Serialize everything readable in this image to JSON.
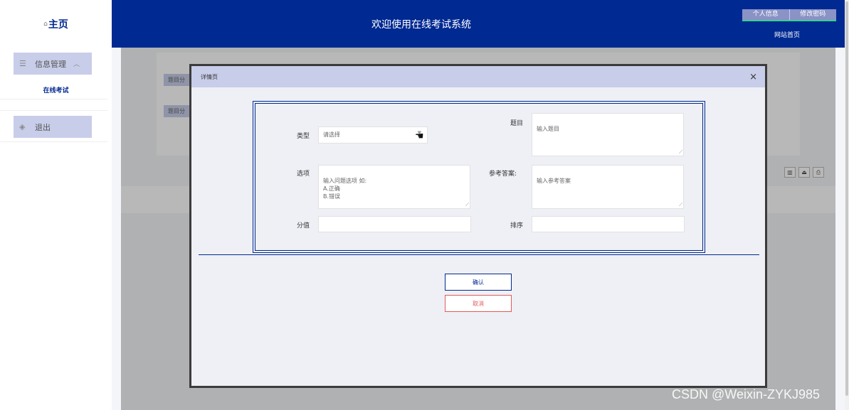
{
  "app": {
    "home_glyph": "⌂",
    "logo_label": "主页",
    "header_title": "欢迎使用在线考试系统"
  },
  "header": {
    "personal_info": "个人信息",
    "change_password": "修改密码",
    "site_home": "网站首页"
  },
  "sidebar": {
    "groups": [
      {
        "label": "信息管理",
        "icon": "list-icon",
        "expanded": true,
        "items": [
          {
            "label": "在线考试"
          }
        ]
      },
      {
        "label": "退出",
        "icon": "layers-icon"
      }
    ]
  },
  "background": {
    "btn1": "题目分",
    "btn2": "题目分"
  },
  "dialog": {
    "title": "详情页",
    "fields": {
      "type": {
        "label": "类型",
        "placeholder": "请选择"
      },
      "question": {
        "label": "题目",
        "placeholder": "输入题目"
      },
      "options": {
        "label": "选项",
        "placeholder": "输入问题选项 如:\n  A.正确\n  B.错误"
      },
      "answer": {
        "label": "参考答案:",
        "placeholder": "输入参考答案"
      },
      "score": {
        "label": "分值",
        "value": ""
      },
      "order": {
        "label": "排序",
        "value": ""
      }
    },
    "confirm": "确认",
    "cancel": "取消"
  },
  "watermark": "CSDN @Weixin-ZYKJ985",
  "colors": {
    "primary": "#002992",
    "sidebar_active": "#c8cde9",
    "cancel": "#e25a5a"
  }
}
